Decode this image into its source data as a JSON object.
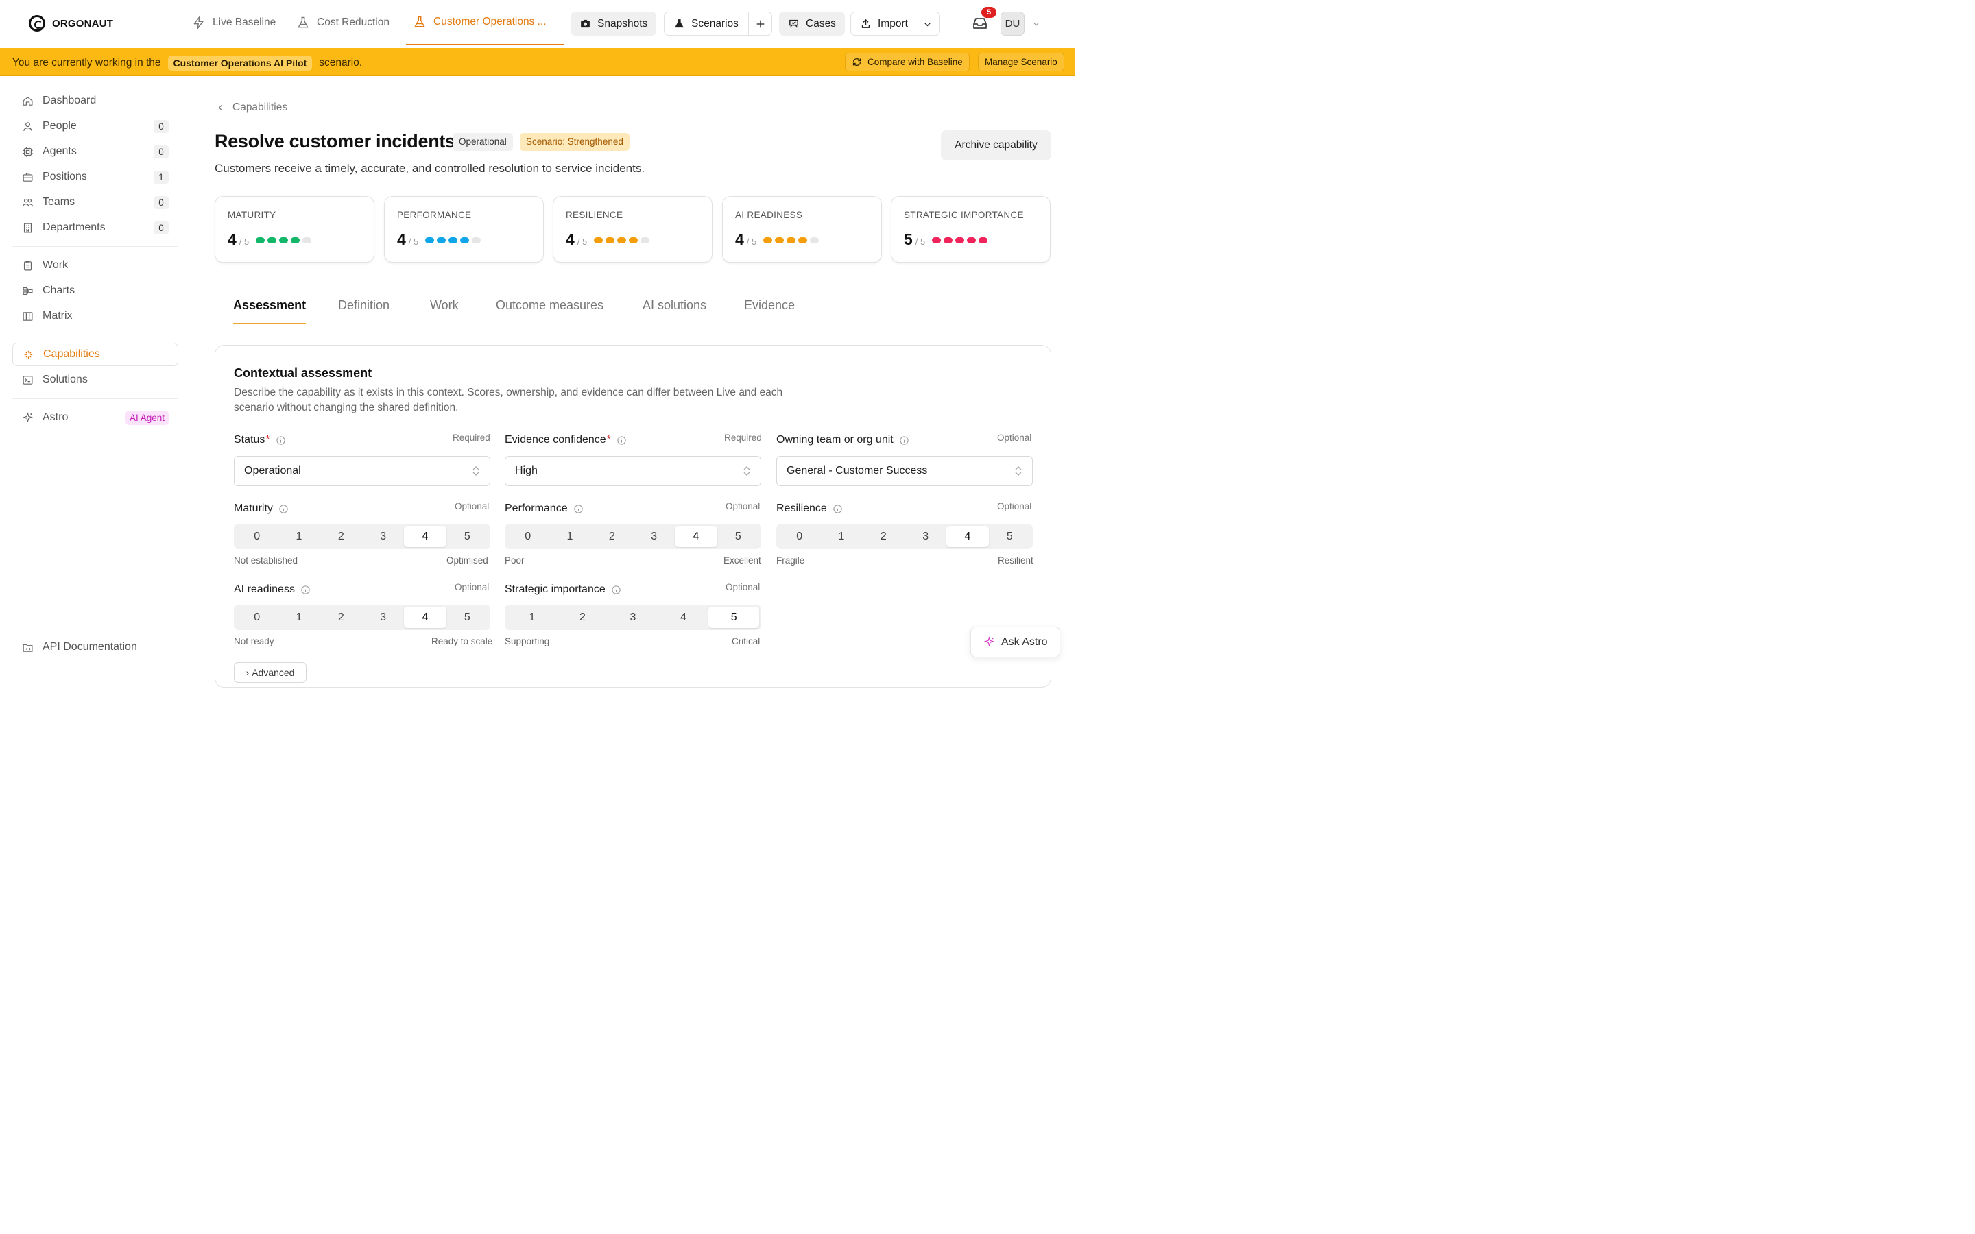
{
  "app": {
    "brand": "ORGONAUT"
  },
  "topnav": {
    "tabs": [
      {
        "label": "Live Baseline",
        "icon": "lightning-icon"
      },
      {
        "label": "Cost Reduction",
        "icon": "flask-icon"
      },
      {
        "label": "Customer Operations ...",
        "icon": "flask-icon",
        "active": true
      }
    ],
    "snapshots": "Snapshots",
    "scenarios": "Scenarios",
    "cases": "Cases",
    "import": "Import",
    "notifications_count": "5",
    "avatar_initials": "DU"
  },
  "banner": {
    "prefix": "You are currently working in the",
    "scenario_name": "Customer Operations AI Pilot",
    "suffix": "scenario.",
    "compare": "Compare with Baseline",
    "manage": "Manage Scenario"
  },
  "sidebar": {
    "items": [
      {
        "label": "Dashboard",
        "icon": "home-icon"
      },
      {
        "label": "People",
        "icon": "person-icon",
        "count": "0"
      },
      {
        "label": "Agents",
        "icon": "chip-icon",
        "count": "0"
      },
      {
        "label": "Positions",
        "icon": "briefcase-icon",
        "count": "1"
      },
      {
        "label": "Teams",
        "icon": "team-icon",
        "count": "0"
      },
      {
        "label": "Departments",
        "icon": "building-icon",
        "count": "0"
      },
      {
        "label": "Work",
        "icon": "clipboard-icon"
      },
      {
        "label": "Charts",
        "icon": "org-chart-icon"
      },
      {
        "label": "Matrix",
        "icon": "columns-icon"
      },
      {
        "label": "Capabilities",
        "icon": "sparkle-icon",
        "active": true
      },
      {
        "label": "Solutions",
        "icon": "terminal-icon"
      },
      {
        "label": "Astro",
        "icon": "sparkle-icon",
        "tag": "AI Agent"
      },
      {
        "label": "API Documentation",
        "icon": "folder-code-icon"
      }
    ]
  },
  "page": {
    "breadcrumb": "Capabilities",
    "title": "Resolve customer incidents",
    "status_tag": "Operational",
    "scenario_tag": "Scenario: Strengthened",
    "archive": "Archive capability",
    "subtitle": "Customers receive a timely, accurate, and controlled resolution to service incidents.",
    "metrics": [
      {
        "label": "MATURITY",
        "score": "4",
        "max": "/ 5",
        "value": 4,
        "color": "#12b76a"
      },
      {
        "label": "PERFORMANCE",
        "score": "4",
        "max": "/ 5",
        "value": 4,
        "color": "#0ea5e9"
      },
      {
        "label": "RESILIENCE",
        "score": "4",
        "max": "/ 5",
        "value": 4,
        "color": "#f59e0b"
      },
      {
        "label": "AI READINESS",
        "score": "4",
        "max": "/ 5",
        "value": 4,
        "color": "#f59e0b"
      },
      {
        "label": "STRATEGIC IMPORTANCE",
        "score": "5",
        "max": "/ 5",
        "value": 5,
        "color": "#f0245a"
      }
    ],
    "tabs": [
      "Assessment",
      "Definition",
      "Work",
      "Outcome measures",
      "AI solutions",
      "Evidence"
    ],
    "active_tab": "Assessment"
  },
  "assessment": {
    "title": "Contextual assessment",
    "description": "Describe the capability as it exists in this context. Scores, ownership, and evidence can differ between Live and each scenario without changing the shared definition.",
    "status": {
      "label": "Status",
      "hint": "Required",
      "value": "Operational"
    },
    "confidence": {
      "label": "Evidence confidence",
      "hint": "Required",
      "value": "High"
    },
    "owner": {
      "label": "Owning team or org unit",
      "hint": "Optional",
      "value": "General - Customer Success"
    },
    "maturity": {
      "label": "Maturity",
      "hint": "Optional",
      "options": [
        "0",
        "1",
        "2",
        "3",
        "4",
        "5"
      ],
      "selected": "4",
      "low": "Not established",
      "high": "Optimised"
    },
    "performance": {
      "label": "Performance",
      "hint": "Optional",
      "options": [
        "0",
        "1",
        "2",
        "3",
        "4",
        "5"
      ],
      "selected": "4",
      "low": "Poor",
      "high": "Excellent"
    },
    "resilience": {
      "label": "Resilience",
      "hint": "Optional",
      "options": [
        "0",
        "1",
        "2",
        "3",
        "4",
        "5"
      ],
      "selected": "4",
      "low": "Fragile",
      "high": "Resilient"
    },
    "ai_readiness": {
      "label": "AI readiness",
      "hint": "Optional",
      "options": [
        "0",
        "1",
        "2",
        "3",
        "4",
        "5"
      ],
      "selected": "4",
      "low": "Not ready",
      "high": "Ready to scale"
    },
    "strategic": {
      "label": "Strategic importance",
      "hint": "Optional",
      "options": [
        "1",
        "2",
        "3",
        "4",
        "5"
      ],
      "selected": "5",
      "low": "Supporting",
      "high": "Critical"
    },
    "advanced": "Advanced"
  },
  "ask_astro": "Ask Astro"
}
